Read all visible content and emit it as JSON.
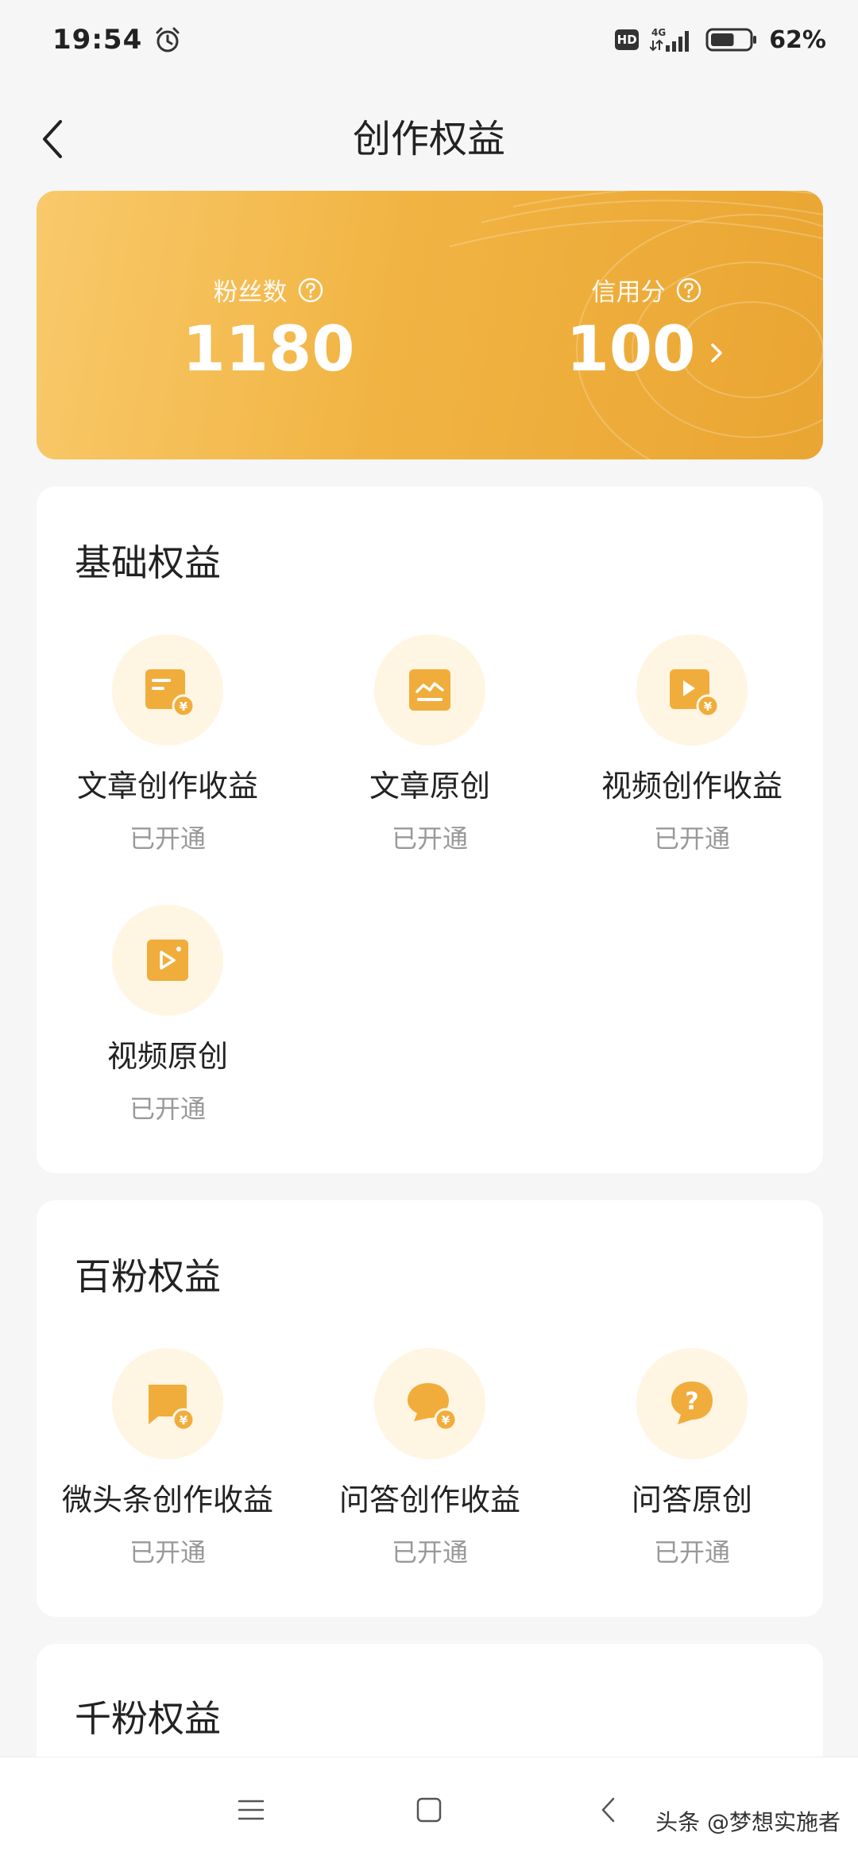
{
  "status_bar": {
    "time": "19:54",
    "network": "4G",
    "hd_badge": "HD",
    "battery": "62%",
    "battery_level": 0.62
  },
  "header": {
    "title": "创作权益"
  },
  "stats": {
    "fans_label": "粉丝数",
    "fans_value": "1180",
    "credit_label": "信用分",
    "credit_value": "100"
  },
  "sections": [
    {
      "title": "基础权益",
      "items": [
        {
          "name": "文章创作收益",
          "status": "已开通",
          "icon": "article-income-icon"
        },
        {
          "name": "文章原创",
          "status": "已开通",
          "icon": "article-original-icon"
        },
        {
          "name": "视频创作收益",
          "status": "已开通",
          "icon": "video-income-icon"
        },
        {
          "name": "视频原创",
          "status": "已开通",
          "icon": "video-original-icon"
        }
      ]
    },
    {
      "title": "百粉权益",
      "items": [
        {
          "name": "微头条创作收益",
          "status": "已开通",
          "icon": "micro-headline-income-icon"
        },
        {
          "name": "问答创作收益",
          "status": "已开通",
          "icon": "qa-income-icon"
        },
        {
          "name": "问答原创",
          "status": "已开通",
          "icon": "qa-original-icon"
        }
      ]
    },
    {
      "title": "千粉权益",
      "items": []
    }
  ],
  "watermark": "头条 @梦想实施者",
  "colors": {
    "accent": "#f1b443",
    "accent_dark": "#eaa532",
    "icon_bg": "#fff5e3",
    "muted_text": "#999999"
  }
}
